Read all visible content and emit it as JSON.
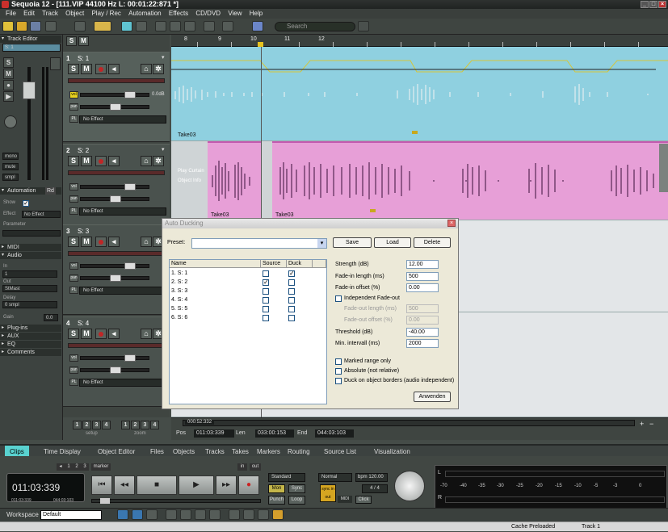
{
  "app": {
    "title": "Sequoia 12 - [111.VIP   44100 Hz L: 00:01:22:871 *]"
  },
  "menu": [
    "File",
    "Edit",
    "Track",
    "Object",
    "Play / Rec",
    "Automation",
    "Effects",
    "CD/DVD",
    "View",
    "Help"
  ],
  "toolbar": {
    "search_placeholder": "Search"
  },
  "left_panel": {
    "track_editor_label": "Track Editor",
    "track_selector": "S: 1",
    "automation_label": "Automation",
    "automation_mode": "Rd",
    "show_label": "Show",
    "effect_label": "Effect",
    "effect_value": "No Effect",
    "parameter_label": "Parameter",
    "midi_label": "MIDI",
    "audio_label": "Audio",
    "in_label": "In",
    "in_value": "1",
    "out_label": "Out",
    "out_value": "StMast",
    "delay_label": "Delay",
    "delay_value": "0 smpl",
    "gain_label": "Gain",
    "gain_value": "0.0",
    "plugins_label": "Plug-ins",
    "aux_label": "AUX",
    "eq_label": "EQ",
    "comments_label": "Comments",
    "mono_label": "mono",
    "mute_label": "mute",
    "smpl_label": "smpl",
    "setup_numbers": [
      "1",
      "2",
      "3",
      "4"
    ],
    "setup_label": "setup",
    "zoom_numbers": [
      "1",
      "2",
      "3",
      "4"
    ],
    "zoom_label": "zoom"
  },
  "tracks": [
    {
      "num": "1",
      "name": "S: 1",
      "vol_value": "0.0dB",
      "pan_value": "",
      "plugin": "No Effect",
      "take": "Take03"
    },
    {
      "num": "2",
      "name": "S: 2",
      "vol_value": "",
      "pan_value": "",
      "plugin": "No Effect",
      "take": "Take03",
      "take2": "Take03",
      "bg_labels": [
        "Play Curtain",
        "Object Info"
      ]
    },
    {
      "num": "3",
      "name": "S: 3",
      "vol_value": "",
      "pan_value": "",
      "plugin": "No Effect"
    },
    {
      "num": "4",
      "name": "S: 4",
      "vol_value": "",
      "pan_value": "",
      "plugin": "No Effect"
    }
  ],
  "ruler": {
    "labels": [
      "8",
      "9",
      "10",
      "11",
      "12"
    ]
  },
  "bottom_status": {
    "pos_label": "Pos",
    "pos_value": "011:03:339",
    "len_label": "Len",
    "len_value": "033:00:153",
    "end_label": "End",
    "end_value": "044:03:103",
    "scroll_value": "000:52:332"
  },
  "dialog": {
    "title": "Auto Ducking",
    "preset_label": "Preset:",
    "preset_value": "",
    "save_label": "Save",
    "load_label": "Load",
    "delete_label": "Delete",
    "columns": [
      "Name",
      "Source",
      "Duck"
    ],
    "rows": [
      {
        "name": "1. S: 1",
        "source": false,
        "duck": true
      },
      {
        "name": "2. S: 2",
        "source": true,
        "duck": false
      },
      {
        "name": "3. S: 3",
        "source": false,
        "duck": false
      },
      {
        "name": "4. S: 4",
        "source": false,
        "duck": false
      },
      {
        "name": "5. S: 5",
        "source": false,
        "duck": false
      },
      {
        "name": "6. S: 6",
        "source": false,
        "duck": false
      }
    ],
    "strength_label": "Strength (dB)",
    "strength_value": "12.00",
    "fadein_len_label": "Fade-in length (ms)",
    "fadein_len_value": "500",
    "fadein_off_label": "Fade-in offset (%)",
    "fadein_off_value": "0.00",
    "indep_fadeout_label": "Independent Fade-out",
    "fadeout_len_label": "Fade-out length (ms)",
    "fadeout_len_value": "500",
    "fadeout_off_label": "Fade-out offset (%)",
    "fadeout_off_value": "0.00",
    "threshold_label": "Threshold (dB)",
    "threshold_value": "-40.00",
    "min_interval_label": "Min. intervall (ms)",
    "min_interval_value": "2000",
    "marked_range_label": "Marked range only",
    "absolute_label": "Absolute (not relative)",
    "duck_borders_label": "Duck on object borders (audio independent)",
    "apply_label": "Anwenden"
  },
  "tabs": [
    "Clips",
    "Time Display",
    "Object Editor",
    "Files",
    "Objects",
    "Tracks",
    "Takes",
    "Markers",
    "Routing",
    "Source List",
    "Visualization"
  ],
  "transport": {
    "time_main": "011:03:339",
    "time_small_left": "011:03:339",
    "time_small_right": "044:03:103",
    "marker_label": "marker",
    "in_label": "in",
    "out_label": "out",
    "mode_standard": "Standard",
    "mon_label": "Mon",
    "sync_label": "Sync",
    "punch_label": "Punch",
    "loop_label": "Loop",
    "normal_label": "Normal",
    "bpm_label": "bpm 120.00",
    "signature": "4 / 4",
    "sync_in_out": "sync in out",
    "midi_label": "MIDI",
    "click_label": "Click",
    "marker_numbers": [
      "1",
      "2",
      "3"
    ]
  },
  "meter": {
    "left_label": "L",
    "right_label": "R",
    "scale": [
      "-70",
      "-40",
      "-35",
      "-30",
      "-25",
      "-20",
      "-15",
      "-10",
      "-5",
      "-3",
      "0"
    ]
  },
  "workspace": {
    "label": "Workspace",
    "value": "Default"
  },
  "statusbar": {
    "cache": "Cache Preloaded",
    "track": "Track 1"
  }
}
